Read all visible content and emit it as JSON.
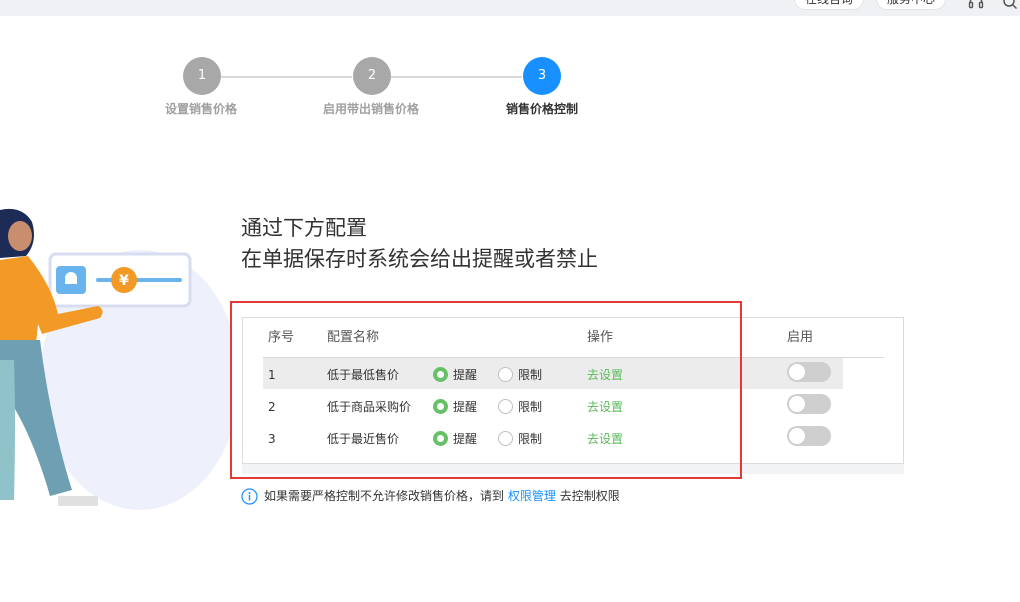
{
  "topbar": {
    "consult_label": "在线咨询",
    "service_label": "服务中心"
  },
  "steps": [
    {
      "number": "1",
      "label": "设置销售价格",
      "state": "done"
    },
    {
      "number": "2",
      "label": "启用带出销售价格",
      "state": "done"
    },
    {
      "number": "3",
      "label": "销售价格控制",
      "state": "active"
    }
  ],
  "heading": {
    "line1": "通过下方配置",
    "line2": "在单据保存时系统会给出提醒或者禁止"
  },
  "table": {
    "headers": {
      "index": "序号",
      "name": "配置名称",
      "action": "操作",
      "enable": "启用"
    },
    "rows": [
      {
        "index": "1",
        "name": "低于最低售价",
        "remind": "提醒",
        "limit": "限制",
        "selected": "remind",
        "action": "去设置",
        "enabled": false
      },
      {
        "index": "2",
        "name": "低于商品采购价",
        "remind": "提醒",
        "limit": "限制",
        "selected": "remind",
        "action": "去设置",
        "enabled": false
      },
      {
        "index": "3",
        "name": "低于最近售价",
        "remind": "提醒",
        "limit": "限制",
        "selected": "remind",
        "action": "去设置",
        "enabled": false
      }
    ]
  },
  "note": {
    "prefix": "如果需要严格控制不允许修改销售价格，请到",
    "link": "权限管理",
    "suffix": "去控制权限"
  },
  "colors": {
    "accent": "#1890ff",
    "success": "#5bbb5b",
    "highlight": "#e53935"
  },
  "icons": {
    "note": "info-icon",
    "illustration_bell": "bell-icon",
    "illustration_coin": "yen-coin-icon"
  }
}
